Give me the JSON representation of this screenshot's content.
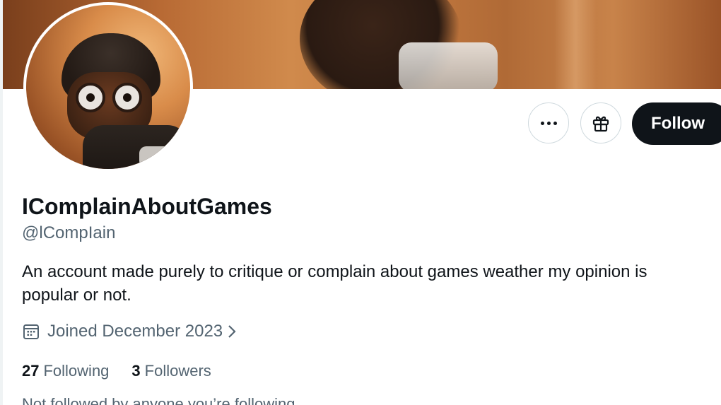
{
  "profile": {
    "display_name": "IComplainAboutGames",
    "handle": "@lCompIain",
    "bio": "An account made purely to critique or complain about games weather my opinion is popular or not.",
    "joined": "Joined December 2023",
    "following_count": "27",
    "following_label": "Following",
    "followers_count": "3",
    "followers_label": "Followers",
    "followed_by": "Not followed by anyone you’re following"
  },
  "actions": {
    "more_icon": "more-icon",
    "gift_icon": "gift-icon",
    "follow_label": "Follow"
  },
  "icons": {
    "calendar": "calendar-icon",
    "chevron": "chevron-right-icon"
  },
  "colors": {
    "text_primary": "#0f1419",
    "text_secondary": "#536471",
    "follow_bg": "#0f1419",
    "border": "#cfd9de"
  }
}
